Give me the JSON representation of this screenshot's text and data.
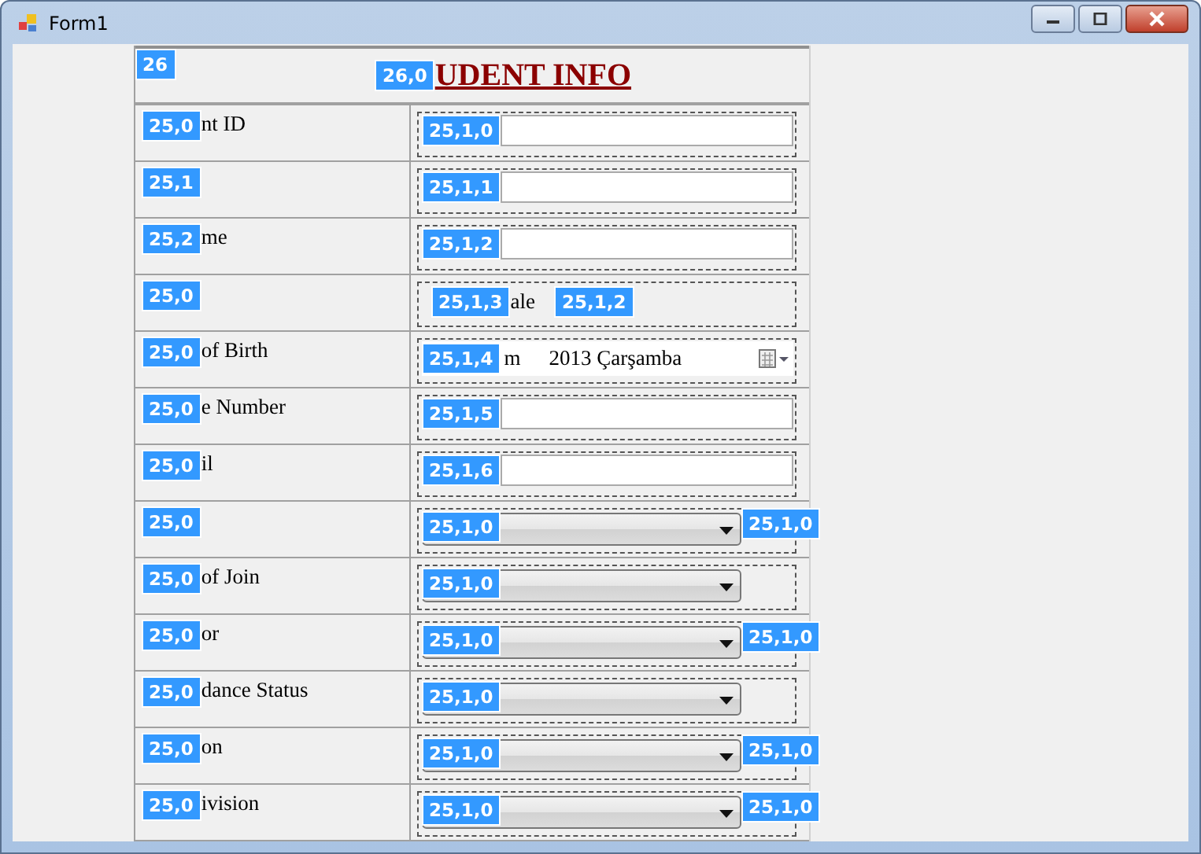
{
  "window": {
    "title": "Form1"
  },
  "header": {
    "badges": [
      "26",
      "26,0"
    ],
    "title": "UDENT INFO"
  },
  "rows": [
    {
      "badge": "25,0",
      "label": "nt ID",
      "kind": "textbox",
      "field_badge": "25,1,0"
    },
    {
      "badge": "25,1",
      "kind": "textbox",
      "field_badge": "25,1,1"
    },
    {
      "badge": "25,2",
      "label": "me",
      "kind": "textbox",
      "field_badge": "25,1,2"
    },
    {
      "badge": "25,0",
      "kind": "radio",
      "field_badge": "25,1,3",
      "option_text": "ale",
      "second_badge": "25,1,2"
    },
    {
      "badge": "25,0",
      "label": "of Birth",
      "kind": "date",
      "field_badge": "25,1,4",
      "text_1": "m",
      "text_2": "2013 Çarşamba"
    },
    {
      "badge": "25,0",
      "label": "e Number",
      "kind": "textbox",
      "field_badge": "25,1,5"
    },
    {
      "badge": "25,0",
      "label": "il",
      "kind": "textbox",
      "field_badge": "25,1,6"
    },
    {
      "badge": "25,0",
      "kind": "combo",
      "field_badge": "25,1,0",
      "extra_badge": "25,1,0"
    },
    {
      "badge": "25,0",
      "label": "of Join",
      "kind": "combo",
      "field_badge": "25,1,0"
    },
    {
      "badge": "25,0",
      "label": "or",
      "kind": "combo",
      "field_badge": "25,1,0",
      "extra_badge": "25,1,0"
    },
    {
      "badge": "25,0",
      "label": "dance Status",
      "kind": "combo",
      "field_badge": "25,1,0"
    },
    {
      "badge": "25,0",
      "label": "on",
      "kind": "combo",
      "field_badge": "25,1,0",
      "extra_badge": "25,1,0"
    },
    {
      "badge": "25,0",
      "label": "ivision",
      "kind": "combo",
      "field_badge": "25,1,0",
      "extra_badge": "25,1,0"
    }
  ]
}
